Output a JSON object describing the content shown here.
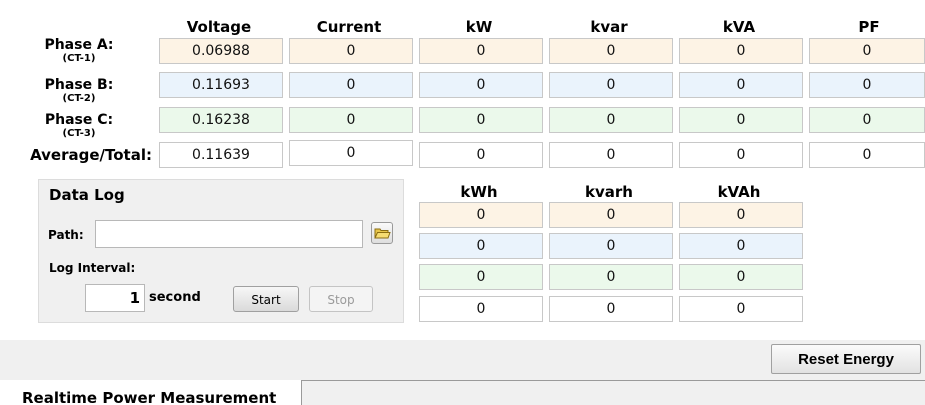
{
  "table": {
    "headers": [
      "Voltage",
      "Current",
      "kW",
      "kvar",
      "kVA",
      "PF"
    ],
    "rows": [
      {
        "label": "Phase A:",
        "sub": "(CT-1)",
        "values": [
          "0.06988",
          "0",
          "0",
          "0",
          "0",
          "0"
        ]
      },
      {
        "label": "Phase B:",
        "sub": "(CT-2)",
        "values": [
          "0.11693",
          "0",
          "0",
          "0",
          "0",
          "0"
        ]
      },
      {
        "label": "Phase C:",
        "sub": "(CT-3)",
        "values": [
          "0.16238",
          "0",
          "0",
          "0",
          "0",
          "0"
        ]
      },
      {
        "label": "Average/Total:",
        "values": [
          "0.11639",
          "0",
          "0",
          "0",
          "0",
          "0"
        ]
      }
    ]
  },
  "energy": {
    "headers": [
      "kWh",
      "kvarh",
      "kVAh"
    ],
    "rows": [
      [
        "0",
        "0",
        "0"
      ],
      [
        "0",
        "0",
        "0"
      ],
      [
        "0",
        "0",
        "0"
      ],
      [
        "0",
        "0",
        "0"
      ]
    ]
  },
  "data_log": {
    "title": "Data Log",
    "path_label": "Path:",
    "path_value": "",
    "folder_icon": "folder-open-icon",
    "interval_label": "Log Interval:",
    "interval_value": "1",
    "interval_unit": "second",
    "start_label": "Start",
    "stop_label": "Stop"
  },
  "reset_label": "Reset Energy",
  "tabs": [
    {
      "label": "Realtime Power Measurement",
      "active": true
    }
  ],
  "colors": {
    "phase_a": "#fdf3e5",
    "phase_b": "#eaf3fc",
    "phase_c": "#ebf9eb",
    "total": "#ffffff",
    "panel_bg": "#f0f0f0"
  }
}
